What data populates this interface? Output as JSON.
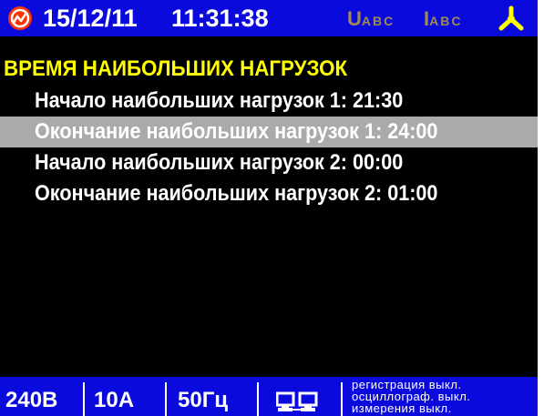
{
  "status_bar": {
    "date": "15/12/11",
    "time": "11:31:38",
    "u_label": "U",
    "u_sub": "ABC",
    "i_label": "I",
    "i_sub": "ABC",
    "logo_icon": "no-signal-logo-icon",
    "phase_icon": "three-phase-icon",
    "colors": {
      "bar_background": "#0a0adc",
      "logo": "#ff3300",
      "indicator_inactive": "#a08a55",
      "phase_icon": "#ffff00"
    }
  },
  "menu": {
    "title": "ВРЕМЯ НАИБОЛЬШИХ НАГРУЗОК",
    "items": [
      {
        "label": "Начало наибольших нагрузок 1: 21:30",
        "selected": false
      },
      {
        "label": "Окончание наибольших нагрузок 1: 24:00",
        "selected": true
      },
      {
        "label": "Начало наибольших нагрузок 2: 00:00",
        "selected": false
      },
      {
        "label": "Окончание наибольших нагрузок 2: 01:00",
        "selected": false
      }
    ],
    "colors": {
      "title": "#ffff00",
      "item_text": "#ffffff",
      "selected_background": "#aaaaaa"
    }
  },
  "bottom_bar": {
    "voltage": "240В",
    "current": "10А",
    "frequency": "50Гц",
    "network_icon": "network-computers-icon",
    "info": [
      "регистрация выкл.",
      "осциллограф. выкл.",
      "измерения выкл."
    ]
  }
}
